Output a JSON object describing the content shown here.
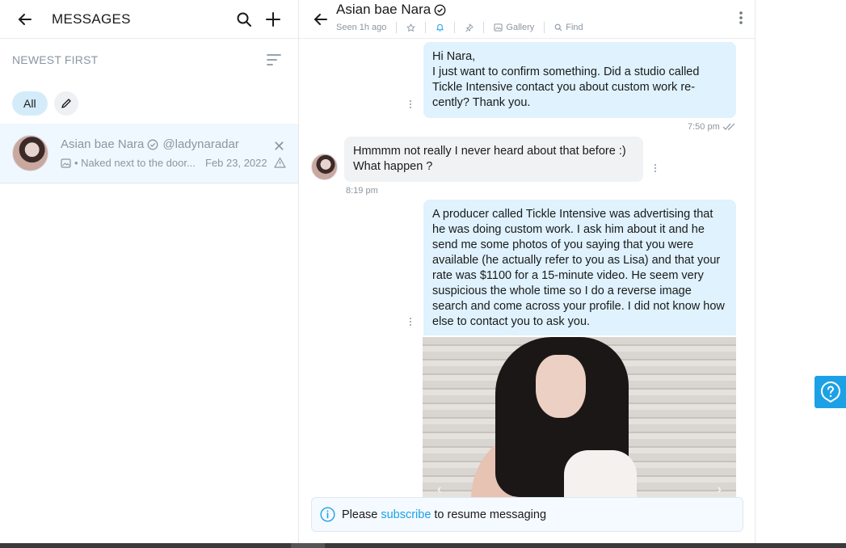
{
  "left": {
    "title": "MESSAGES",
    "sort_label": "NEWEST FIRST",
    "filter_all": "All",
    "conversation": {
      "name": "Asian bae Nara",
      "handle": "@ladynaradar",
      "preview": "• Naked next to the door...",
      "date": "Feb 23, 2022"
    }
  },
  "chat": {
    "name": "Asian bae Nara",
    "seen": "Seen 1h ago",
    "gallery": "Gallery",
    "find": "Find"
  },
  "messages": [
    {
      "dir": "out",
      "text": "Hi Nara,\nI just want to confirm something. Did a studio called Tickle Intensive contact you about custom work re-cently? Thank you.",
      "time": "7:50 pm"
    },
    {
      "dir": "in",
      "text": "Hmmmm not really I never heard about that before :)\nWhat happen ?",
      "time": "8:19 pm"
    },
    {
      "dir": "out",
      "text": "A producer called Tickle Intensive was advertising that he was doing custom work. I ask him about it and he send me some photos of you saying that you were available (he actually refer to you as Lisa) and that your rate was $1100 for a 15-minute video. He seem very suspicious the whole time so I do a reverse image search and come across your profile. I did not know how else to contact you to ask you."
    }
  ],
  "notice": {
    "before": "Please",
    "link": "subscribe",
    "after": "to resume messaging"
  },
  "colors": {
    "accent": "#1da1e6",
    "bubble_out": "#dff2fd",
    "bubble_in": "#f0f2f4",
    "muted": "#8a96a3"
  },
  "icons": [
    "back-arrow-icon",
    "search-icon",
    "plus-icon",
    "sort-icon",
    "pencil-icon",
    "verified-icon",
    "close-icon",
    "warning-icon",
    "star-icon",
    "bell-icon",
    "pin-icon",
    "gallery-icon",
    "find-icon",
    "more-icon",
    "info-icon",
    "help-icon"
  ]
}
